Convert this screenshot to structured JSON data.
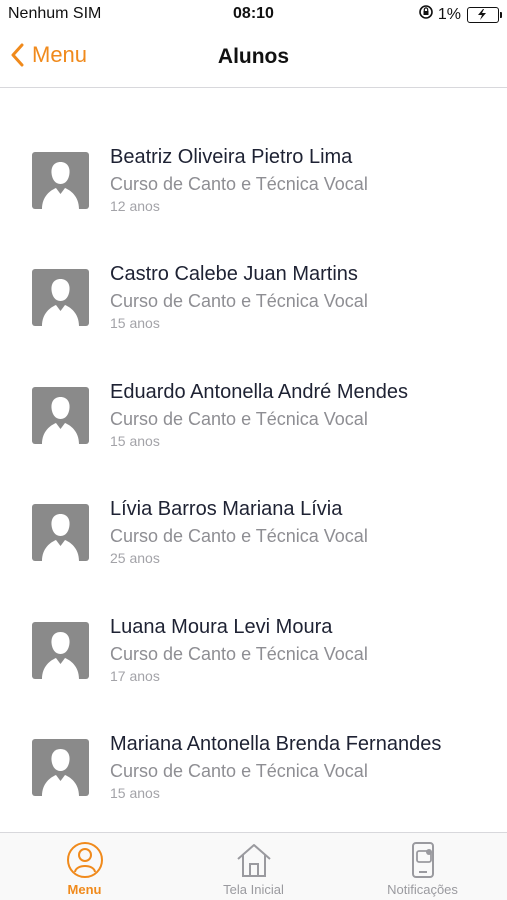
{
  "status_bar": {
    "carrier": "Nenhum SIM",
    "time": "08:10",
    "battery": "1%"
  },
  "nav": {
    "back_label": "Menu",
    "title": "Alunos"
  },
  "students": [
    {
      "name": "Beatriz Oliveira Pietro Lima",
      "course": "Curso de Canto e Técnica Vocal",
      "age": "12 anos"
    },
    {
      "name": "Castro Calebe Juan Martins",
      "course": "Curso de Canto e Técnica Vocal",
      "age": "15 anos"
    },
    {
      "name": "Eduardo Antonella André Mendes",
      "course": "Curso de Canto e Técnica Vocal",
      "age": "15 anos"
    },
    {
      "name": "Lívia Barros Mariana Lívia",
      "course": "Curso de Canto e Técnica Vocal",
      "age": "25 anos"
    },
    {
      "name": "Luana Moura Levi Moura",
      "course": "Curso de Canto e Técnica Vocal",
      "age": "17 anos"
    },
    {
      "name": "Mariana Antonella Brenda Fernandes",
      "course": "Curso de Canto e Técnica Vocal",
      "age": "15 anos"
    }
  ],
  "tabs": [
    {
      "label": "Menu",
      "icon": "person-circle-icon",
      "active": true
    },
    {
      "label": "Tela Inicial",
      "icon": "home-icon",
      "active": false
    },
    {
      "label": "Notificações",
      "icon": "phone-notification-icon",
      "active": false
    }
  ],
  "colors": {
    "accent": "#f08a1c",
    "avatar_bg": "#8a8a8a",
    "secondary_text": "#8e8e93"
  }
}
